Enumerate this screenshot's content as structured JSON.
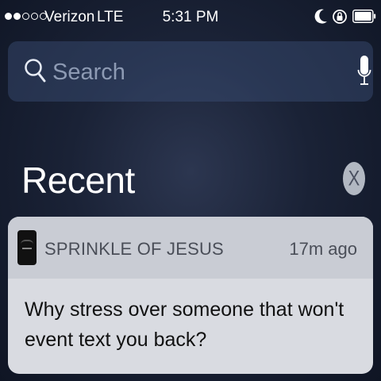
{
  "status_bar": {
    "signal_bars": 2,
    "signal_total": 5,
    "carrier": "Verizon",
    "network": "LTE",
    "time": "5:31 PM",
    "icons": [
      "moon-icon",
      "rotation-lock-icon",
      "battery-icon"
    ]
  },
  "search": {
    "placeholder": "Search",
    "icon": "search-icon",
    "mic_icon": "microphone-icon"
  },
  "recent": {
    "title": "Recent",
    "clear_label": "X"
  },
  "notification": {
    "app_name": "SPRINKLE OF JESUS",
    "time": "17m ago",
    "message": "Why stress over someone that won't event text you back?"
  }
}
